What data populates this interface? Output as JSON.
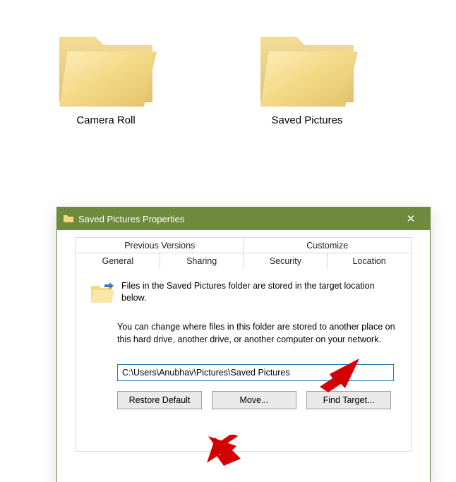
{
  "desktop": {
    "folders": [
      {
        "label": "Camera Roll"
      },
      {
        "label": "Saved Pictures"
      }
    ]
  },
  "dialog": {
    "title": "Saved Pictures Properties",
    "close_glyph": "✕",
    "tabs_row1": [
      "Previous Versions",
      "Customize"
    ],
    "tabs_row2": [
      "General",
      "Sharing",
      "Security",
      "Location"
    ],
    "info_line": "Files in the Saved Pictures folder are stored in the target location below.",
    "paragraph": "You can change where files in this folder are stored to another place on this hard drive, another drive, or another computer on your network.",
    "path_value": "C:\\Users\\Anubhav\\Pictures\\Saved Pictures",
    "buttons": {
      "restore": "Restore Default",
      "move": "Move...",
      "find": "Find Target..."
    }
  }
}
